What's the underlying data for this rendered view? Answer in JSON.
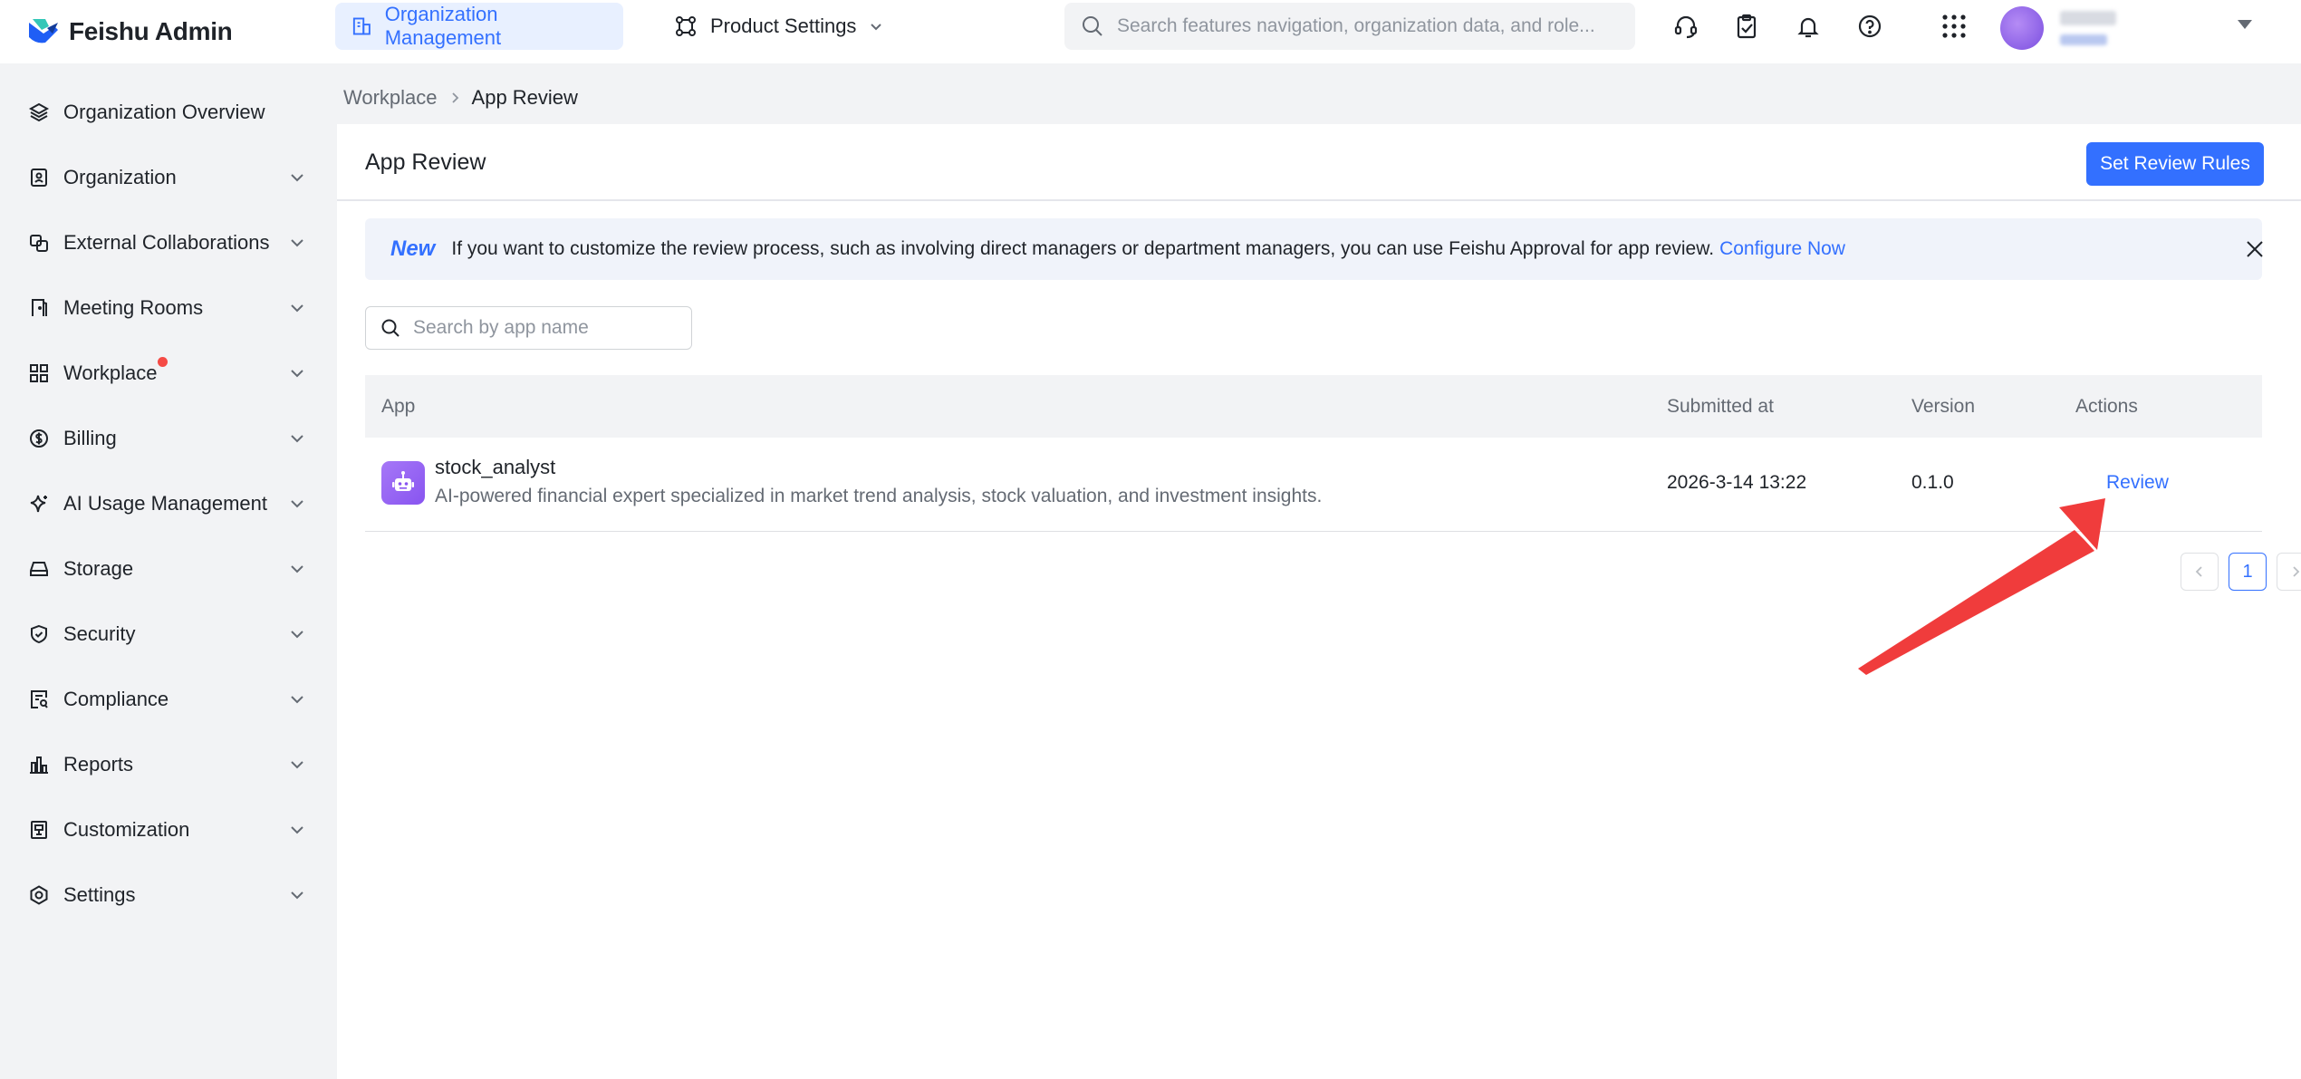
{
  "app": {
    "name": "Feishu Admin"
  },
  "topnav": {
    "org_tab": "Organization Management",
    "product_tab": "Product Settings",
    "search_placeholder": "Search features navigation, organization data, and role..."
  },
  "sidebar": {
    "items": [
      {
        "label": "Organization Overview",
        "icon": "layers-icon",
        "expandable": false
      },
      {
        "label": "Organization",
        "icon": "badge-icon",
        "expandable": true
      },
      {
        "label": "External Collaborations",
        "icon": "link-icon",
        "expandable": true
      },
      {
        "label": "Meeting Rooms",
        "icon": "door-icon",
        "expandable": true
      },
      {
        "label": "Workplace",
        "icon": "grid-icon",
        "expandable": true,
        "has_notification_dot": true
      },
      {
        "label": "Billing",
        "icon": "dollar-icon",
        "expandable": true
      },
      {
        "label": "AI Usage Management",
        "icon": "sparkle-icon",
        "expandable": true
      },
      {
        "label": "Storage",
        "icon": "drive-icon",
        "expandable": true
      },
      {
        "label": "Security",
        "icon": "shield-icon",
        "expandable": true
      },
      {
        "label": "Compliance",
        "icon": "compliance-icon",
        "expandable": true
      },
      {
        "label": "Reports",
        "icon": "bar-chart-icon",
        "expandable": true
      },
      {
        "label": "Customization",
        "icon": "customize-icon",
        "expandable": true
      },
      {
        "label": "Settings",
        "icon": "hexagon-gear-icon",
        "expandable": true
      }
    ]
  },
  "breadcrumb": {
    "parent": "Workplace",
    "current": "App Review"
  },
  "page": {
    "title": "App Review",
    "primary_button": "Set Review Rules"
  },
  "notice": {
    "badge": "New",
    "text": "If you want to customize the review process, such as involving direct managers or department managers, you can use Feishu Approval for app review.",
    "link": "Configure Now"
  },
  "search": {
    "placeholder": "Search by app name",
    "value": ""
  },
  "table": {
    "columns": [
      "App",
      "Submitted at",
      "Version",
      "Actions"
    ],
    "rows": [
      {
        "name": "stock_analyst",
        "description": "AI-powered financial expert specialized in market trend analysis, stock valuation, and investment insights.",
        "submitted_at": "2026-3-14 13:22",
        "version": "0.1.0",
        "action": "Review"
      }
    ]
  },
  "pagination": {
    "current_page": "1"
  },
  "colors": {
    "accent": "#3370ff",
    "annotation_arrow": "#f03c3c",
    "notification_dot": "#f54a45"
  }
}
